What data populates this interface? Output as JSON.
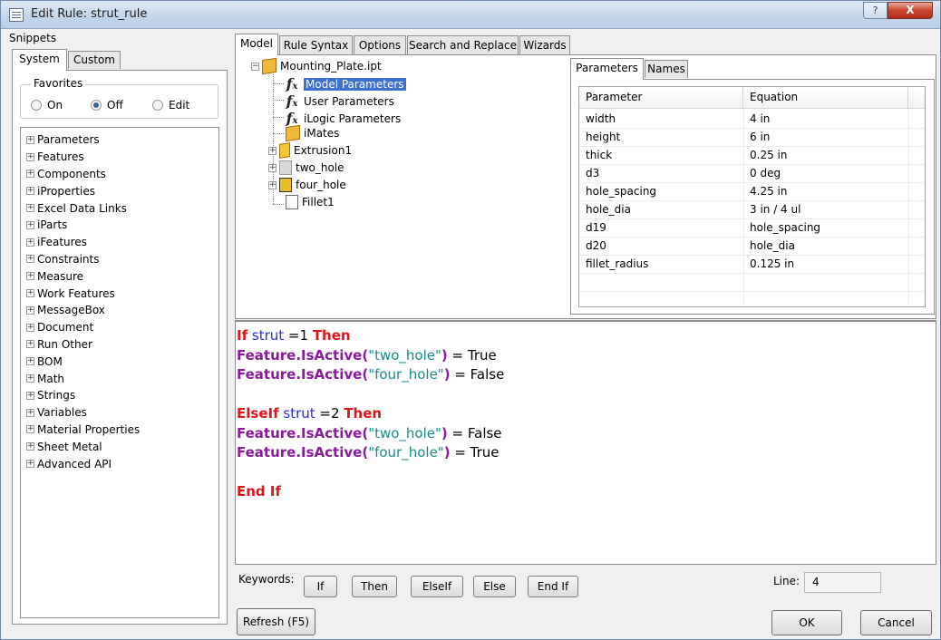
{
  "window": {
    "title": "Edit Rule: strut_rule",
    "help_label": "?",
    "close_label": "X"
  },
  "snippets": {
    "label": "Snippets",
    "tabs": [
      "System",
      "Custom"
    ],
    "favorites": {
      "label": "Favorites",
      "options": [
        "On",
        "Off",
        "Edit"
      ],
      "selected": "Off"
    },
    "items": [
      "Parameters",
      "Features",
      "Components",
      "iProperties",
      "Excel Data Links",
      "iParts",
      "iFeatures",
      "Constraints",
      "Measure",
      "Work Features",
      "MessageBox",
      "Document",
      "Run Other",
      "BOM",
      "Math",
      "Strings",
      "Variables",
      "Material Properties",
      "Sheet Metal",
      "Advanced API"
    ]
  },
  "main_tabs": [
    "Model",
    "Rule Syntax",
    "Options",
    "Search and Replace",
    "Wizards"
  ],
  "model_tree": {
    "root": "Mounting_Plate.ipt",
    "children": [
      "Model Parameters",
      "User Parameters",
      "iLogic Parameters",
      "iMates",
      "Extrusion1",
      "two_hole",
      "four_hole",
      "Fillet1"
    ],
    "selected": "Model Parameters"
  },
  "params": {
    "tabs": [
      "Parameters",
      "Names"
    ],
    "columns": [
      "Parameter",
      "Equation"
    ],
    "rows": [
      [
        "width",
        "4 in"
      ],
      [
        "height",
        "6 in"
      ],
      [
        "thick",
        "0.25 in"
      ],
      [
        "d3",
        "0 deg"
      ],
      [
        "hole_spacing",
        "4.25 in"
      ],
      [
        "hole_dia",
        "3 in / 4 ul"
      ],
      [
        "d19",
        "hole_spacing"
      ],
      [
        "d20",
        "hole_dia"
      ],
      [
        "fillet_radius",
        "0.125 in"
      ]
    ]
  },
  "code": {
    "l1_if": "If",
    "l1_var": "strut",
    "l1_op": " =1 ",
    "l1_then": "Then",
    "feature_call": "Feature.IsActive",
    "l2_arg": "\"two_hole\"",
    "l2_val": " = True",
    "l3_arg": "\"four_hole\"",
    "l3_val": " = False",
    "l5_elseif": "ElseIf",
    "l5_var": "strut",
    "l5_op": " =2 ",
    "l5_then": "Then",
    "l6_arg": "\"two_hole\"",
    "l6_val": " = False",
    "l7_arg": "\"four_hole\"",
    "l7_val": " = True",
    "l9_endif": "End If"
  },
  "keywords": {
    "label": "Keywords:",
    "buttons": [
      "If",
      "Then",
      "ElseIf",
      "Else",
      "End If"
    ]
  },
  "line": {
    "label": "Line:",
    "value": "4"
  },
  "buttons": {
    "refresh": "Refresh (F5)",
    "ok": "OK",
    "cancel": "Cancel"
  }
}
